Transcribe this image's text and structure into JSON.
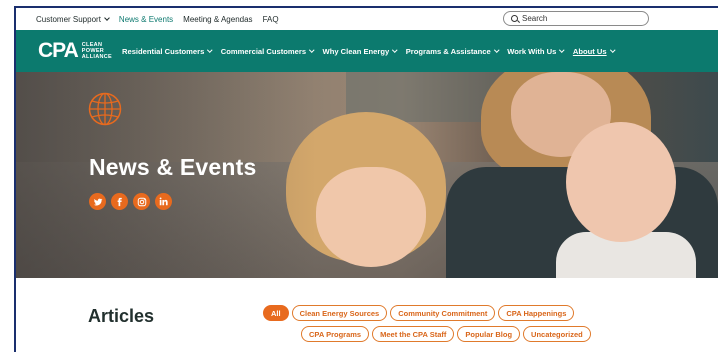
{
  "utility": {
    "items": [
      {
        "label": "Customer Support",
        "has_dropdown": true,
        "active": false
      },
      {
        "label": "News & Events",
        "has_dropdown": false,
        "active": true
      },
      {
        "label": "Meeting & Agendas",
        "has_dropdown": false,
        "active": false
      },
      {
        "label": "FAQ",
        "has_dropdown": false,
        "active": false
      }
    ],
    "search_label": "Search"
  },
  "logo": {
    "mark": "CPA",
    "line1": "CLEAN",
    "line2": "POWER",
    "line3": "ALLIANCE"
  },
  "nav": {
    "items": [
      {
        "label": "Residential Customers"
      },
      {
        "label": "Commercial Customers"
      },
      {
        "label": "Why Clean Energy"
      },
      {
        "label": "Programs & Assistance"
      },
      {
        "label": "Work With Us"
      },
      {
        "label": "About Us"
      }
    ]
  },
  "hero": {
    "title": "News & Events",
    "socials": [
      "twitter-icon",
      "facebook-icon",
      "instagram-icon",
      "linkedin-icon"
    ]
  },
  "articles": {
    "title": "Articles",
    "filters_row1": [
      "All",
      "Clean Energy Sources",
      "Community Commitment",
      "CPA Happenings"
    ],
    "filters_row2": [
      "CPA Programs",
      "Meet the CPA Staff",
      "Popular Blog",
      "Uncategorized"
    ],
    "active_filter": "All"
  },
  "colors": {
    "brand_green": "#0c7a6e",
    "accent_orange": "#e86a1e",
    "border_navy": "#1a2f6e"
  }
}
